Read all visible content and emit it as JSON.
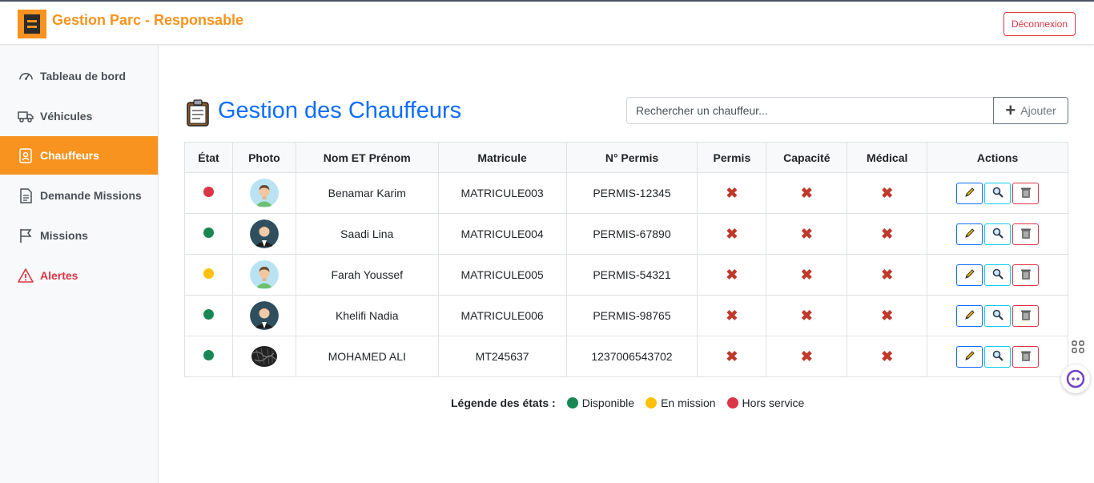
{
  "app": {
    "title": "Gestion Parc - Responsable",
    "logout_label": "Déconnexion"
  },
  "sidebar": {
    "items": [
      {
        "label": "Tableau de bord",
        "icon": "gauge-icon",
        "active": false
      },
      {
        "label": "Véhicules",
        "icon": "truck-icon",
        "active": false
      },
      {
        "label": "Chauffeurs",
        "icon": "id-badge-icon",
        "active": true
      },
      {
        "label": "Demande Missions",
        "icon": "document-icon",
        "active": false
      },
      {
        "label": "Missions",
        "icon": "flag-icon",
        "active": false
      },
      {
        "label": "Alertes",
        "icon": "warning-icon",
        "active": false
      }
    ]
  },
  "page": {
    "title": "Gestion des Chauffeurs",
    "search_placeholder": "Rechercher un chauffeur...",
    "add_label": "Ajouter"
  },
  "table": {
    "headers": [
      "État",
      "Photo",
      "Nom ET Prénom",
      "Matricule",
      "N° Permis",
      "Permis",
      "Capacité",
      "Médical",
      "Actions"
    ],
    "rows": [
      {
        "status": "hors-service",
        "status_color": "#dc3545",
        "photo": "avatar-green",
        "name": "Benamar Karim",
        "matricule": "MATRICULE003",
        "permis_num": "PERMIS-12345",
        "permis": false,
        "capacite": false,
        "medical": false
      },
      {
        "status": "disponible",
        "status_color": "#198754",
        "photo": "avatar-suit",
        "name": "Saadi Lina",
        "matricule": "MATRICULE004",
        "permis_num": "PERMIS-67890",
        "permis": false,
        "capacite": false,
        "medical": false
      },
      {
        "status": "en-mission",
        "status_color": "#ffc107",
        "photo": "avatar-green",
        "name": "Farah Youssef",
        "matricule": "MATRICULE005",
        "permis_num": "PERMIS-54321",
        "permis": false,
        "capacite": false,
        "medical": false
      },
      {
        "status": "disponible",
        "status_color": "#198754",
        "photo": "avatar-suit",
        "name": "Khelifi Nadia",
        "matricule": "MATRICULE006",
        "permis_num": "PERMIS-98765",
        "permis": false,
        "capacite": false,
        "medical": false
      },
      {
        "status": "disponible",
        "status_color": "#198754",
        "photo": "avatar-scribble",
        "name": "MOHAMED ALI",
        "matricule": "MT245637",
        "permis_num": "1237006543702",
        "permis": false,
        "capacite": false,
        "medical": false
      }
    ],
    "cross_symbol": "✖"
  },
  "legend": {
    "label": "Légende des états :",
    "items": [
      {
        "label": "Disponible",
        "color": "#198754"
      },
      {
        "label": "En mission",
        "color": "#ffc107"
      },
      {
        "label": "Hors service",
        "color": "#dc3545"
      }
    ]
  },
  "colors": {
    "brand": "#f7931e",
    "title": "#0d6efd",
    "danger": "#dc3545"
  }
}
